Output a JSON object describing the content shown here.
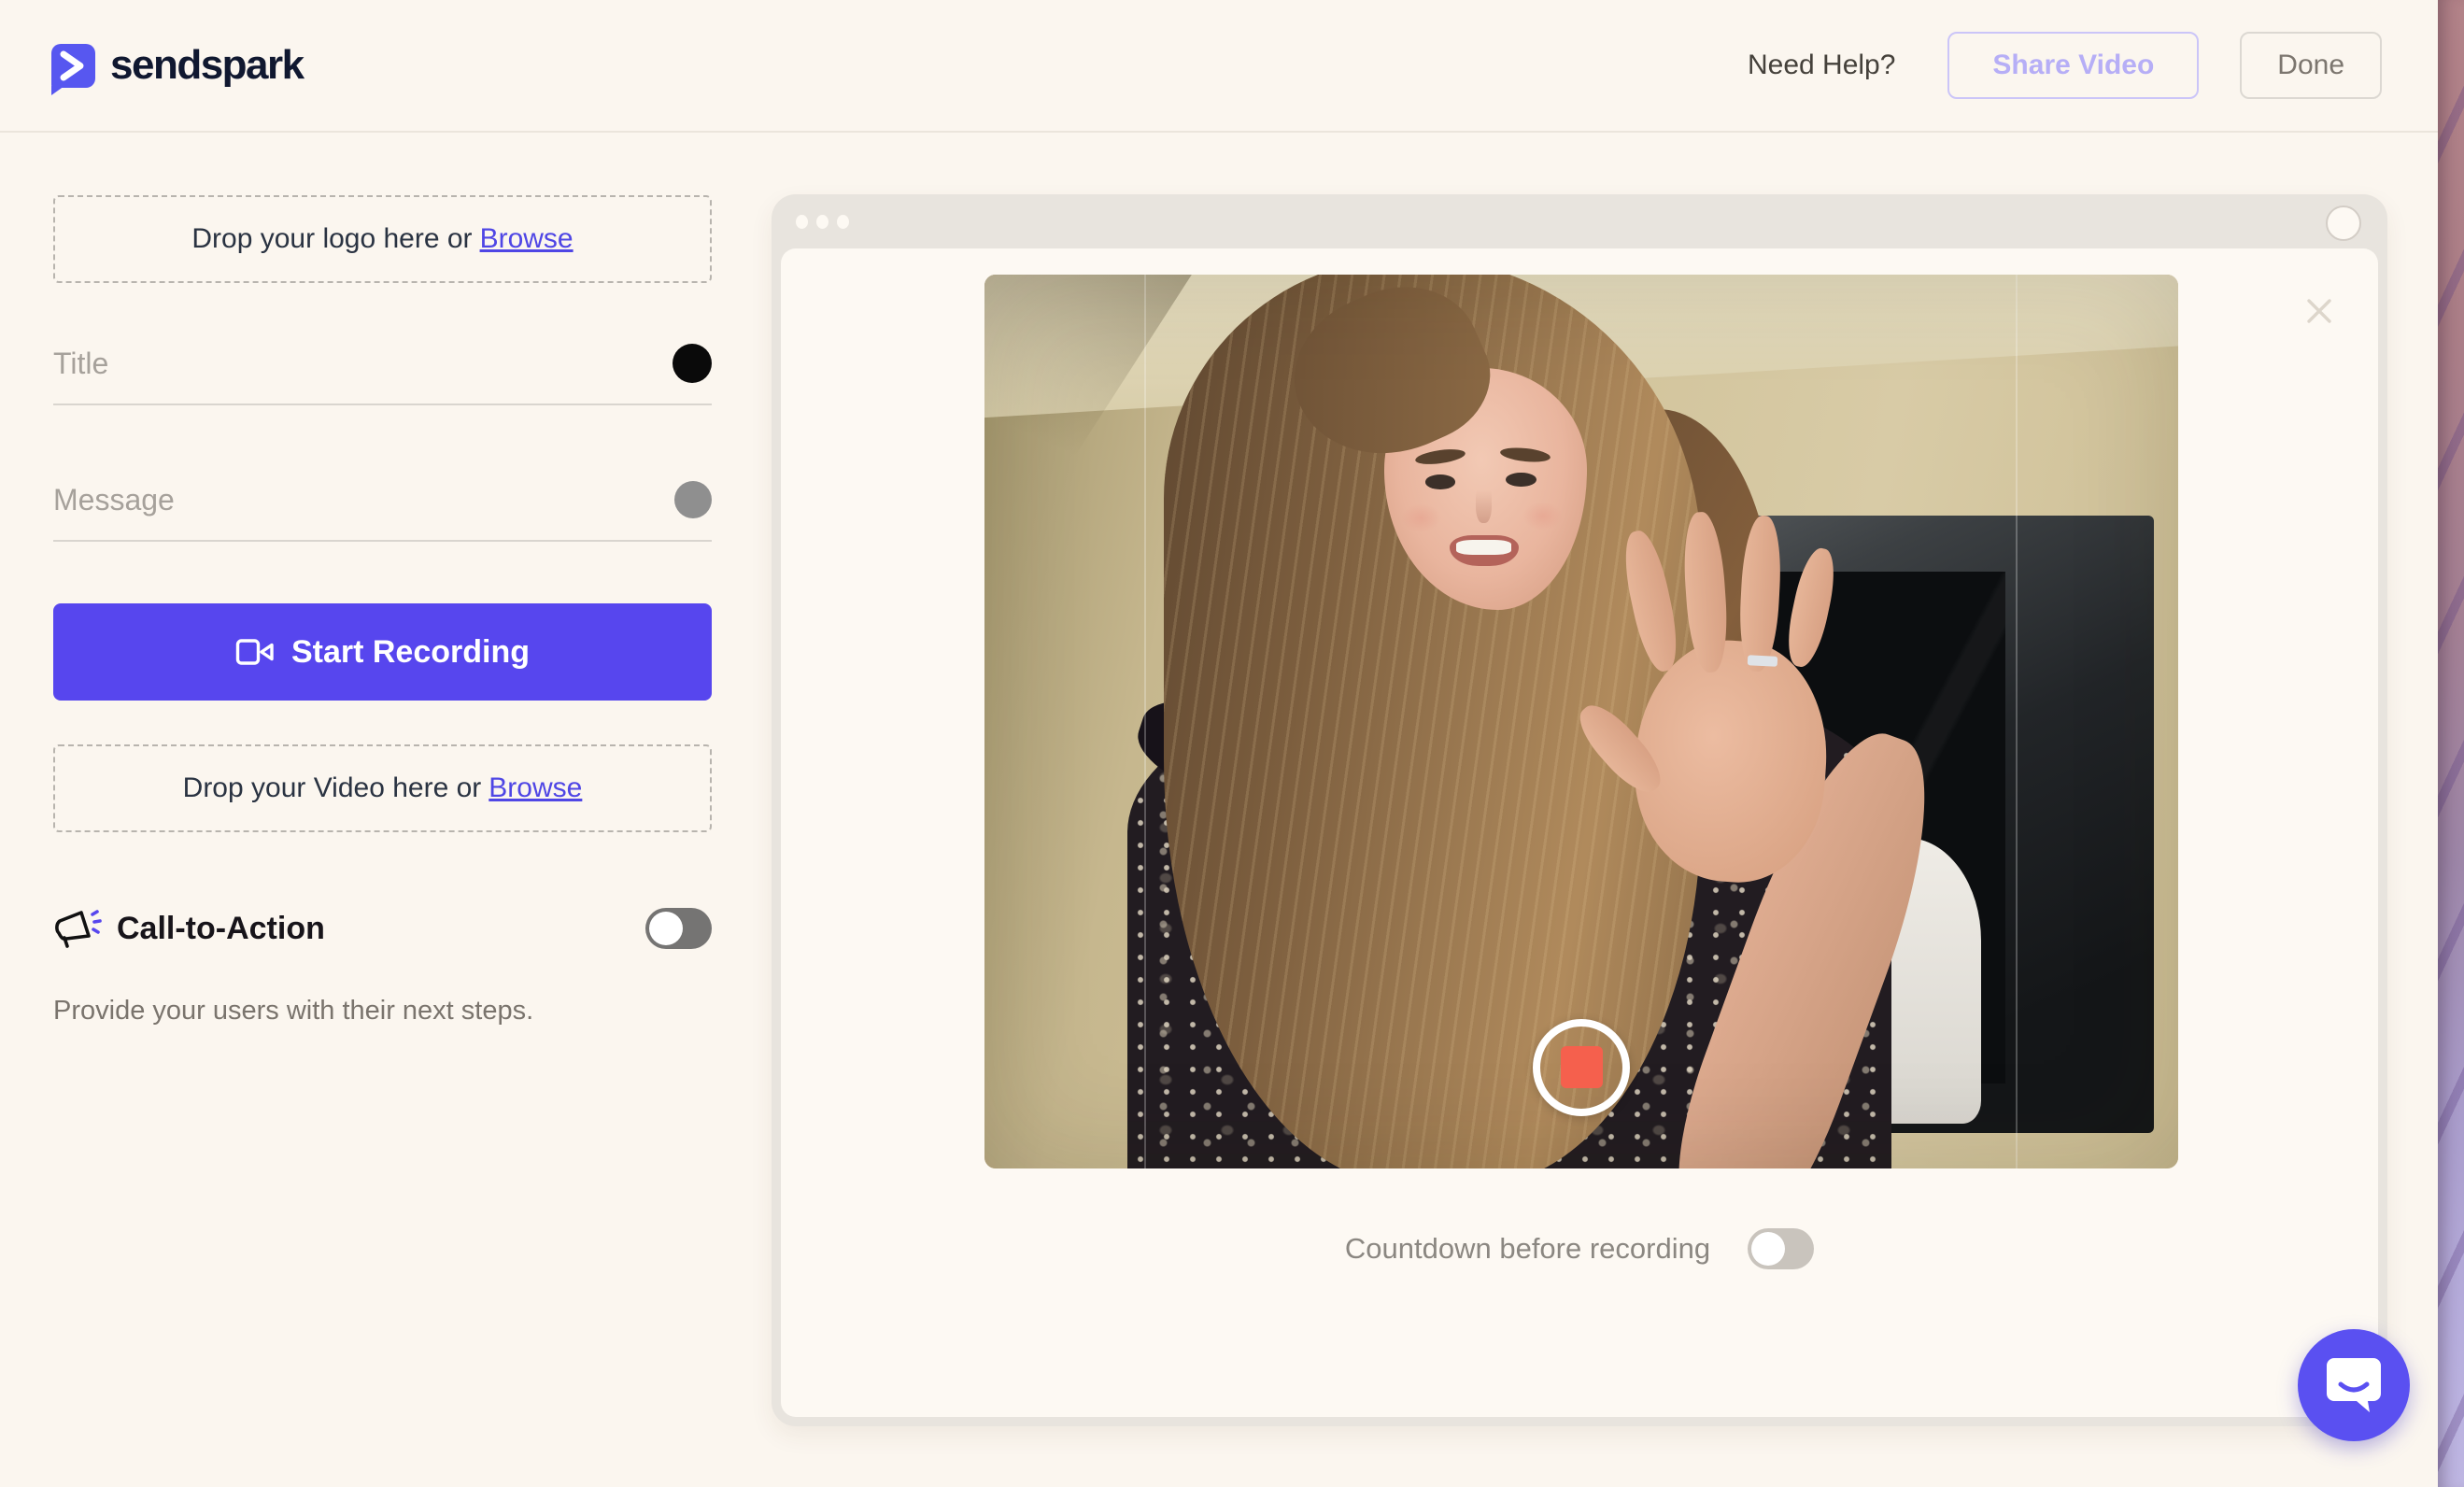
{
  "header": {
    "brand": "sendspark",
    "need_help": "Need Help?",
    "share_video": "Share Video",
    "done": "Done"
  },
  "sidebar": {
    "logo_drop": {
      "text": "Drop your logo here or",
      "browse": "Browse"
    },
    "title": {
      "placeholder": "Title",
      "swatch_color": "#0a0a0a"
    },
    "message": {
      "placeholder": "Message",
      "swatch_color": "#8f8f8f"
    },
    "start_recording": "Start Recording",
    "video_drop": {
      "text": "Drop your Video here or",
      "browse": "Browse"
    },
    "cta": {
      "label": "Call-to-Action",
      "enabled": false,
      "description": "Provide your users with their next steps."
    }
  },
  "recorder": {
    "countdown_label": "Countdown before recording",
    "countdown_enabled": false,
    "state": "recording-preview"
  },
  "icons": {
    "brand": "sendspark-bubble-chevron",
    "start_button": "videocam-icon",
    "cta": "megaphone-icon",
    "record": "stop-record-square",
    "launcher": "intercom-chat-bubble"
  },
  "colors": {
    "accent": "#5746ee",
    "brand_icon": "#5757f0",
    "link": "#4f46e5",
    "record_red": "#f5604d",
    "intercom": "#5a50f1",
    "page_bg": "#fbf6ef",
    "card_frame": "#e8e4de"
  }
}
